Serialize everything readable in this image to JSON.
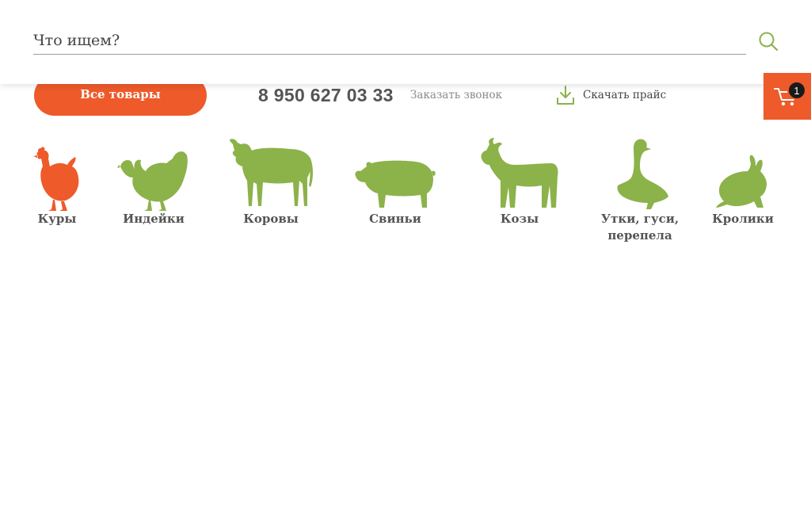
{
  "search": {
    "placeholder": "Что ищем?",
    "value": ""
  },
  "header": {
    "all_products_label": "Все товары",
    "phone": "8 950 627 03 33",
    "callback_label": "Заказать звонок",
    "download_label": "Скачать прайс"
  },
  "cart": {
    "count": "1"
  },
  "categories": [
    {
      "label": "Куры",
      "icon": "chicken-icon",
      "color": "#ee5a2a"
    },
    {
      "label": "Индейки",
      "icon": "turkey-icon",
      "color": "#8cb24a"
    },
    {
      "label": "Коровы",
      "icon": "cow-icon",
      "color": "#8cb24a"
    },
    {
      "label": "Свиньи",
      "icon": "pig-icon",
      "color": "#8cb24a"
    },
    {
      "label": "Козы",
      "icon": "goat-icon",
      "color": "#8cb24a"
    },
    {
      "label": "Утки, гуси, перепела",
      "icon": "goose-icon",
      "color": "#8cb24a"
    },
    {
      "label": "Кролики",
      "icon": "rabbit-icon",
      "color": "#8cb24a"
    }
  ],
  "colors": {
    "accent": "#ee5a2a",
    "green": "#8cb24a",
    "text": "#555555"
  }
}
